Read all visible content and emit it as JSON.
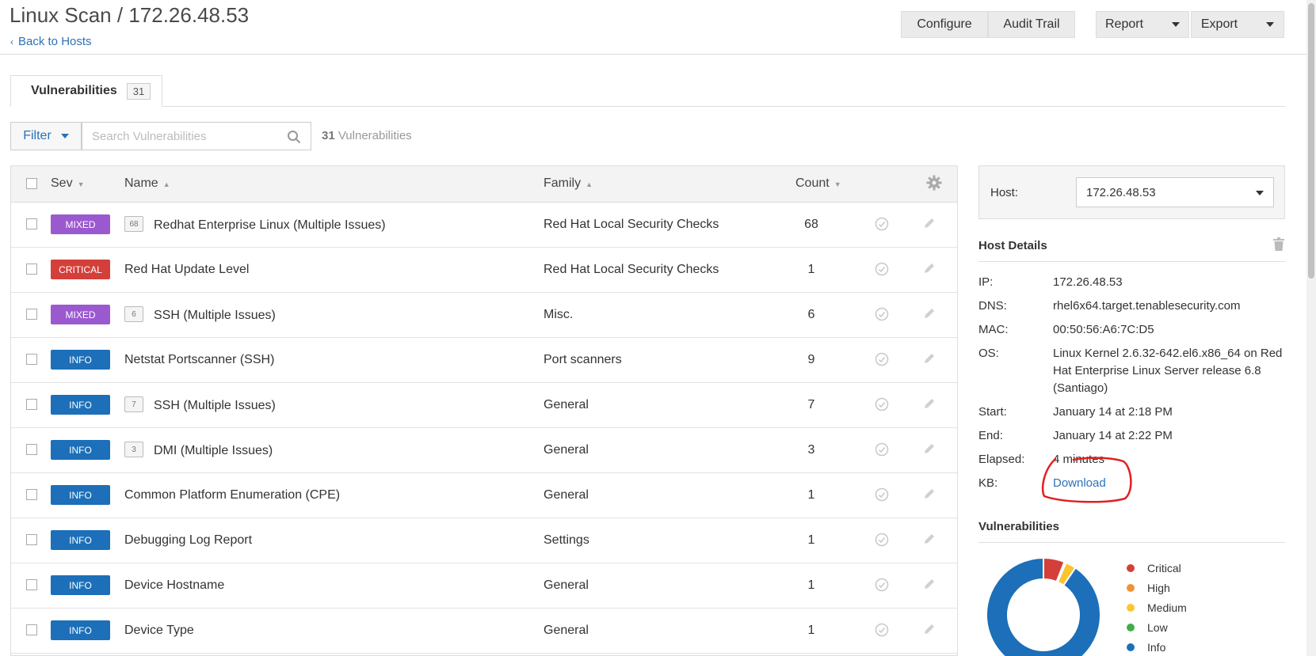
{
  "header": {
    "title": "Linux Scan / 172.26.48.53",
    "back_link": "Back to Hosts",
    "buttons": {
      "configure": "Configure",
      "audit_trail": "Audit Trail",
      "report": "Report",
      "export": "Export"
    }
  },
  "tabs": [
    {
      "label": "Vulnerabilities",
      "count": "31"
    }
  ],
  "toolbar": {
    "filter_label": "Filter",
    "search_placeholder": "Search Vulnerabilities",
    "count_number": "31",
    "count_label": " Vulnerabilities"
  },
  "table": {
    "columns": {
      "sev": "Sev",
      "name": "Name",
      "family": "Family",
      "count": "Count"
    },
    "rows": [
      {
        "sev": "MIXED",
        "sev_color": "#9b59d0",
        "group_count": "68",
        "name": "Redhat Enterprise Linux (Multiple Issues)",
        "family": "Red Hat Local Security Checks",
        "count": "68"
      },
      {
        "sev": "CRITICAL",
        "sev_color": "#d43f3a",
        "group_count": "",
        "name": "Red Hat Update Level",
        "family": "Red Hat Local Security Checks",
        "count": "1"
      },
      {
        "sev": "MIXED",
        "sev_color": "#9b59d0",
        "group_count": "6",
        "name": "SSH (Multiple Issues)",
        "family": "Misc.",
        "count": "6"
      },
      {
        "sev": "INFO",
        "sev_color": "#1c6fb8",
        "group_count": "",
        "name": "Netstat Portscanner (SSH)",
        "family": "Port scanners",
        "count": "9"
      },
      {
        "sev": "INFO",
        "sev_color": "#1c6fb8",
        "group_count": "7",
        "name": "SSH (Multiple Issues)",
        "family": "General",
        "count": "7"
      },
      {
        "sev": "INFO",
        "sev_color": "#1c6fb8",
        "group_count": "3",
        "name": "DMI (Multiple Issues)",
        "family": "General",
        "count": "3"
      },
      {
        "sev": "INFO",
        "sev_color": "#1c6fb8",
        "group_count": "",
        "name": "Common Platform Enumeration (CPE)",
        "family": "General",
        "count": "1"
      },
      {
        "sev": "INFO",
        "sev_color": "#1c6fb8",
        "group_count": "",
        "name": "Debugging Log Report",
        "family": "Settings",
        "count": "1"
      },
      {
        "sev": "INFO",
        "sev_color": "#1c6fb8",
        "group_count": "",
        "name": "Device Hostname",
        "family": "General",
        "count": "1"
      },
      {
        "sev": "INFO",
        "sev_color": "#1c6fb8",
        "group_count": "",
        "name": "Device Type",
        "family": "General",
        "count": "1"
      }
    ]
  },
  "sidebar": {
    "host_label": "Host:",
    "host_value": "172.26.48.53",
    "details_title": "Host Details",
    "details": [
      {
        "key": "IP:",
        "value": "172.26.48.53"
      },
      {
        "key": "DNS:",
        "value": "rhel6x64.target.tenablesecurity.com"
      },
      {
        "key": "MAC:",
        "value": "00:50:56:A6:7C:D5"
      },
      {
        "key": "OS:",
        "value": "Linux Kernel 2.6.32-642.el6.x86_64 on Red Hat Enterprise Linux Server release 6.8 (Santiago)"
      },
      {
        "key": "Start:",
        "value": "January 14 at 2:18 PM"
      },
      {
        "key": "End:",
        "value": "January 14 at 2:22 PM"
      },
      {
        "key": "Elapsed:",
        "value": "4 minutes"
      },
      {
        "key": "KB:",
        "value": "Download",
        "link": true
      }
    ],
    "vulns_title": "Vulnerabilities",
    "legend": [
      {
        "label": "Critical",
        "color": "#d43f3a"
      },
      {
        "label": "High",
        "color": "#ee9336"
      },
      {
        "label": "Medium",
        "color": "#fdc431"
      },
      {
        "label": "Low",
        "color": "#3fae49"
      },
      {
        "label": "Info",
        "color": "#1c6fb8"
      }
    ],
    "donut_share": {
      "Critical": 0.06,
      "High": 0.005,
      "Medium": 0.03,
      "Low": 0,
      "Info": 0.905
    }
  },
  "colors": {
    "accent": "#2b72b8",
    "annotation": "#e02020"
  }
}
